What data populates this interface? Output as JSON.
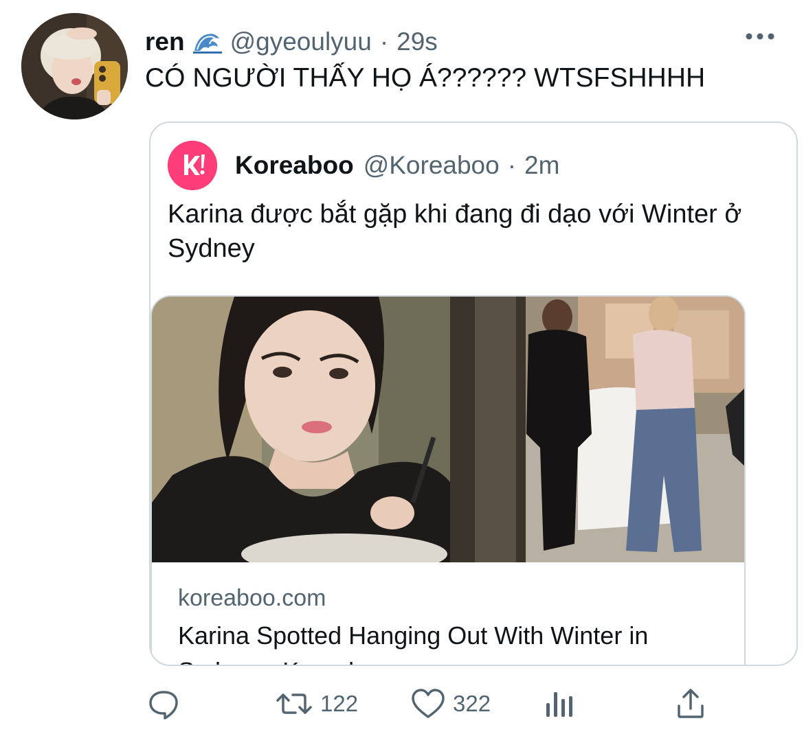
{
  "tweet": {
    "display_name": "ren",
    "display_name_emoji": "wave-emoji",
    "handle": "@gyeoulyuu",
    "separator": "·",
    "time": "29s",
    "text": "CÓ NGƯỜI THẤY HỌ Á?????? WTSFSHHHH"
  },
  "quoted": {
    "display_name": "Koreaboo",
    "handle": "@Koreaboo",
    "separator": "·",
    "time": "2m",
    "avatar_letter": "k!",
    "avatar_color": "#ff3d79",
    "text": "Karina được bắt gặp khi đang đi dạo với Winter ở Sydney",
    "link": {
      "domain": "koreaboo.com",
      "title": "Karina Spotted Hanging Out With Winter in Sydney - Koreaboo"
    }
  },
  "actions": {
    "reply_icon": "reply-icon",
    "retweet_icon": "retweet-icon",
    "retweets": "122",
    "like_icon": "heart-icon",
    "likes": "322",
    "analytics_icon": "analytics-icon",
    "share_icon": "share-icon"
  },
  "colors": {
    "text_primary": "#0f1419",
    "text_secondary": "#536471",
    "border": "#cfd9de",
    "koreaboo_pink": "#ff3d79"
  }
}
